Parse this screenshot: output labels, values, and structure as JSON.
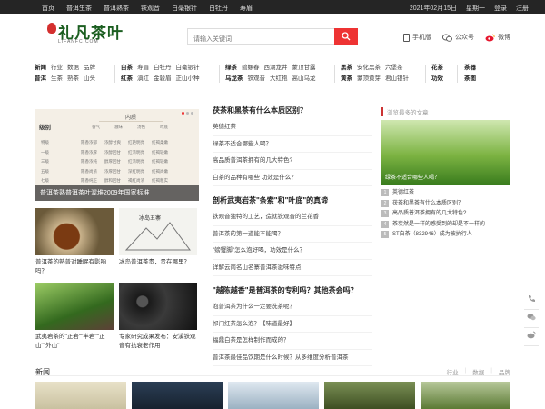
{
  "topbar": {
    "links": [
      "首页",
      "普洱生茶",
      "普洱熟茶",
      "铁观音",
      "白毫银针",
      "白牡丹",
      "寿眉"
    ],
    "date": "2021年02月15日",
    "weekday": "星期一",
    "login": "登录",
    "register": "注册"
  },
  "header": {
    "logo_name": "礼凡茶叶",
    "logo_url": "LIFANFC.COM",
    "search_placeholder": "请输入关键词",
    "mobile": "手机版",
    "wechat": "公众号",
    "weibo": "微博"
  },
  "catnav": [
    {
      "rows": [
        [
          "新闻",
          "行业",
          "数据",
          "品牌"
        ],
        [
          "普洱",
          "生茶",
          "熟茶",
          "山头"
        ]
      ]
    },
    {
      "rows": [
        [
          "白茶",
          "寿眉",
          "白牡丹",
          "白毫银针"
        ],
        [
          "红茶",
          "滇红",
          "金骏眉",
          "正山小种"
        ]
      ]
    },
    {
      "rows": [
        [
          "绿茶",
          "碧螺春",
          "西湖龙井",
          "蒙顶甘露"
        ],
        [
          "乌龙茶",
          "铁观音",
          "大红袍",
          "高山乌龙"
        ]
      ]
    },
    {
      "rows": [
        [
          "黑茶",
          "安化黑茶",
          "六堡茶"
        ],
        [
          "黄茶",
          "蒙顶黄芽",
          "君山银针"
        ]
      ]
    },
    {
      "rows": [
        [
          "花茶"
        ],
        [
          "功效"
        ]
      ]
    },
    {
      "rows": [
        [
          "茶器"
        ],
        [
          "茶图"
        ]
      ]
    }
  ],
  "slider": {
    "caption": "普洱茶熟普洱茶叶渥堆2009年国家标准",
    "table_title": "内质",
    "table_header": [
      "级别",
      "香气",
      "滋味",
      "汤色",
      "叶底"
    ],
    "table_rows": [
      [
        "特级",
        "陈香浓郁",
        "浓醇甘爽",
        "红艳明亮",
        "红褐柔嫩"
      ],
      [
        "一级",
        "陈香浓厚",
        "浓醇回甘",
        "红浓明亮",
        "红褐较嫩"
      ],
      [
        "三级",
        "陈香浓纯",
        "醇厚回甘",
        "红浓明亮",
        "红褐较嫩"
      ],
      [
        "五级",
        "陈香尚浓",
        "浓厚回甘",
        "深红明亮",
        "红褐尚嫩"
      ],
      [
        "七级",
        "陈香纯正",
        "醇和回甘",
        "褐红尚浓",
        "红褐粗实"
      ]
    ]
  },
  "thumbs": [
    {
      "title": "普洱茶的熟普对睡眠有影响吗？"
    },
    {
      "title": "冰岛普洱茶贵，贵在哪里？",
      "img_text": "冰岛五寨"
    },
    {
      "title": "武夷岩茶的\"正岩\"\"半岩\"\"正山\"\"外山\""
    },
    {
      "title": "专家研究成果发布：安溪铁观音有抗衰老作用"
    }
  ],
  "middle": [
    {
      "title": "茯茶和黑茶有什么本质区别？",
      "items": [
        "英德红茶",
        "绿茶不适合哪些人喝？",
        "高品质普洱茶拥有的几大特色?",
        "白茶的品种有哪些 功效是什么？"
      ]
    },
    {
      "title": "剖析武夷岩茶\"条索\"和\"叶底\"的真谛",
      "items": [
        "铁观音独特的工艺，造就铁观音的兰花香",
        "普洱茶的第一道能不能喝？",
        "\"螃蟹脚\"怎么泡好喝，功效是什么？",
        "详解云南名山名寨普洱茶滋味特点"
      ]
    },
    {
      "title": "\"越陈越香\"是普洱茶的专利吗？其他茶会吗？",
      "items": [
        "泡普洱茶为什么一定要洗茶呢？",
        "祁门红茶怎么泡？【味道最好】",
        "福鼎白茶是怎样制作而成的？",
        "普洱茶最佳品饮期是什么时候？从多维度分析普洱茶"
      ]
    }
  ],
  "right": {
    "label": "浏览最多的文章",
    "big_caption": "绿茶不适合哪些人喝？",
    "list": [
      "英德红茶",
      "茯茶和黑茶有什么本质区别？",
      "高品质普洱茶拥有的几大特色?",
      "茶炭然是一样的感受到的却是不一样的",
      "ST白茶（832946）成为被执行人"
    ],
    "nums": [
      "1",
      "2",
      "3",
      "4",
      "5"
    ]
  },
  "news": {
    "heading": "新闻",
    "tabs": [
      "行业",
      "数据",
      "品牌"
    ]
  }
}
